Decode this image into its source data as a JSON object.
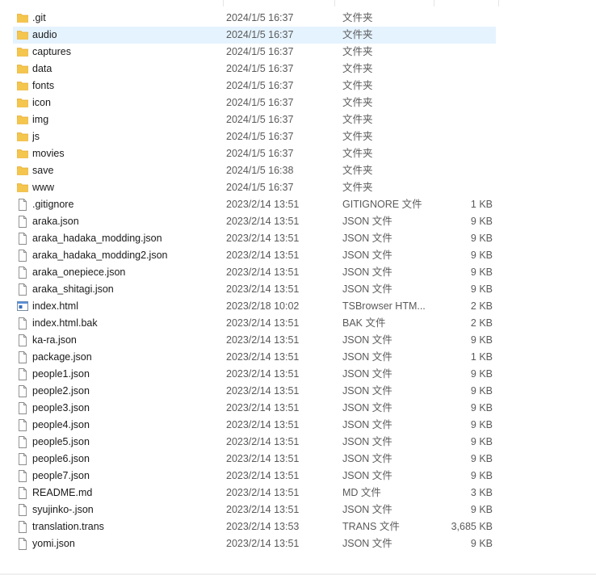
{
  "files": [
    {
      "name": ".git",
      "date": "2024/1/5 16:37",
      "type": "文件夹",
      "size": "",
      "icon": "folder-icon"
    },
    {
      "name": "audio",
      "date": "2024/1/5 16:37",
      "type": "文件夹",
      "size": "",
      "icon": "folder-icon",
      "selected": true
    },
    {
      "name": "captures",
      "date": "2024/1/5 16:37",
      "type": "文件夹",
      "size": "",
      "icon": "folder-icon"
    },
    {
      "name": "data",
      "date": "2024/1/5 16:37",
      "type": "文件夹",
      "size": "",
      "icon": "folder-icon"
    },
    {
      "name": "fonts",
      "date": "2024/1/5 16:37",
      "type": "文件夹",
      "size": "",
      "icon": "folder-icon"
    },
    {
      "name": "icon",
      "date": "2024/1/5 16:37",
      "type": "文件夹",
      "size": "",
      "icon": "folder-icon"
    },
    {
      "name": "img",
      "date": "2024/1/5 16:37",
      "type": "文件夹",
      "size": "",
      "icon": "folder-icon"
    },
    {
      "name": "js",
      "date": "2024/1/5 16:37",
      "type": "文件夹",
      "size": "",
      "icon": "folder-icon"
    },
    {
      "name": "movies",
      "date": "2024/1/5 16:37",
      "type": "文件夹",
      "size": "",
      "icon": "folder-icon"
    },
    {
      "name": "save",
      "date": "2024/1/5 16:38",
      "type": "文件夹",
      "size": "",
      "icon": "folder-icon"
    },
    {
      "name": "www",
      "date": "2024/1/5 16:37",
      "type": "文件夹",
      "size": "",
      "icon": "folder-icon"
    },
    {
      "name": ".gitignore",
      "date": "2023/2/14 13:51",
      "type": "GITIGNORE 文件",
      "size": "1 KB",
      "icon": "file-icon"
    },
    {
      "name": "araka.json",
      "date": "2023/2/14 13:51",
      "type": "JSON 文件",
      "size": "9 KB",
      "icon": "file-icon"
    },
    {
      "name": "araka_hadaka_modding.json",
      "date": "2023/2/14 13:51",
      "type": "JSON 文件",
      "size": "9 KB",
      "icon": "file-icon"
    },
    {
      "name": "araka_hadaka_modding2.json",
      "date": "2023/2/14 13:51",
      "type": "JSON 文件",
      "size": "9 KB",
      "icon": "file-icon"
    },
    {
      "name": "araka_onepiece.json",
      "date": "2023/2/14 13:51",
      "type": "JSON 文件",
      "size": "9 KB",
      "icon": "file-icon"
    },
    {
      "name": "araka_shitagi.json",
      "date": "2023/2/14 13:51",
      "type": "JSON 文件",
      "size": "9 KB",
      "icon": "file-icon"
    },
    {
      "name": "index.html",
      "date": "2023/2/18 10:02",
      "type": "TSBrowser HTM...",
      "size": "2 KB",
      "icon": "html-file-icon"
    },
    {
      "name": "index.html.bak",
      "date": "2023/2/14 13:51",
      "type": "BAK 文件",
      "size": "2 KB",
      "icon": "file-icon"
    },
    {
      "name": "ka-ra.json",
      "date": "2023/2/14 13:51",
      "type": "JSON 文件",
      "size": "9 KB",
      "icon": "file-icon"
    },
    {
      "name": "package.json",
      "date": "2023/2/14 13:51",
      "type": "JSON 文件",
      "size": "1 KB",
      "icon": "file-icon"
    },
    {
      "name": "people1.json",
      "date": "2023/2/14 13:51",
      "type": "JSON 文件",
      "size": "9 KB",
      "icon": "file-icon"
    },
    {
      "name": "people2.json",
      "date": "2023/2/14 13:51",
      "type": "JSON 文件",
      "size": "9 KB",
      "icon": "file-icon"
    },
    {
      "name": "people3.json",
      "date": "2023/2/14 13:51",
      "type": "JSON 文件",
      "size": "9 KB",
      "icon": "file-icon"
    },
    {
      "name": "people4.json",
      "date": "2023/2/14 13:51",
      "type": "JSON 文件",
      "size": "9 KB",
      "icon": "file-icon"
    },
    {
      "name": "people5.json",
      "date": "2023/2/14 13:51",
      "type": "JSON 文件",
      "size": "9 KB",
      "icon": "file-icon"
    },
    {
      "name": "people6.json",
      "date": "2023/2/14 13:51",
      "type": "JSON 文件",
      "size": "9 KB",
      "icon": "file-icon"
    },
    {
      "name": "people7.json",
      "date": "2023/2/14 13:51",
      "type": "JSON 文件",
      "size": "9 KB",
      "icon": "file-icon"
    },
    {
      "name": "README.md",
      "date": "2023/2/14 13:51",
      "type": "MD 文件",
      "size": "3 KB",
      "icon": "file-icon"
    },
    {
      "name": "syujinko-.json",
      "date": "2023/2/14 13:51",
      "type": "JSON 文件",
      "size": "9 KB",
      "icon": "file-icon"
    },
    {
      "name": "translation.trans",
      "date": "2023/2/14 13:53",
      "type": "TRANS 文件",
      "size": "3,685 KB",
      "icon": "file-icon"
    },
    {
      "name": "yomi.json",
      "date": "2023/2/14 13:51",
      "type": "JSON 文件",
      "size": "9 KB",
      "icon": "file-icon"
    }
  ],
  "colors": {
    "folder": "#f4c64e",
    "folder_dark": "#e6a92b",
    "selection": "#e5f3ff"
  }
}
